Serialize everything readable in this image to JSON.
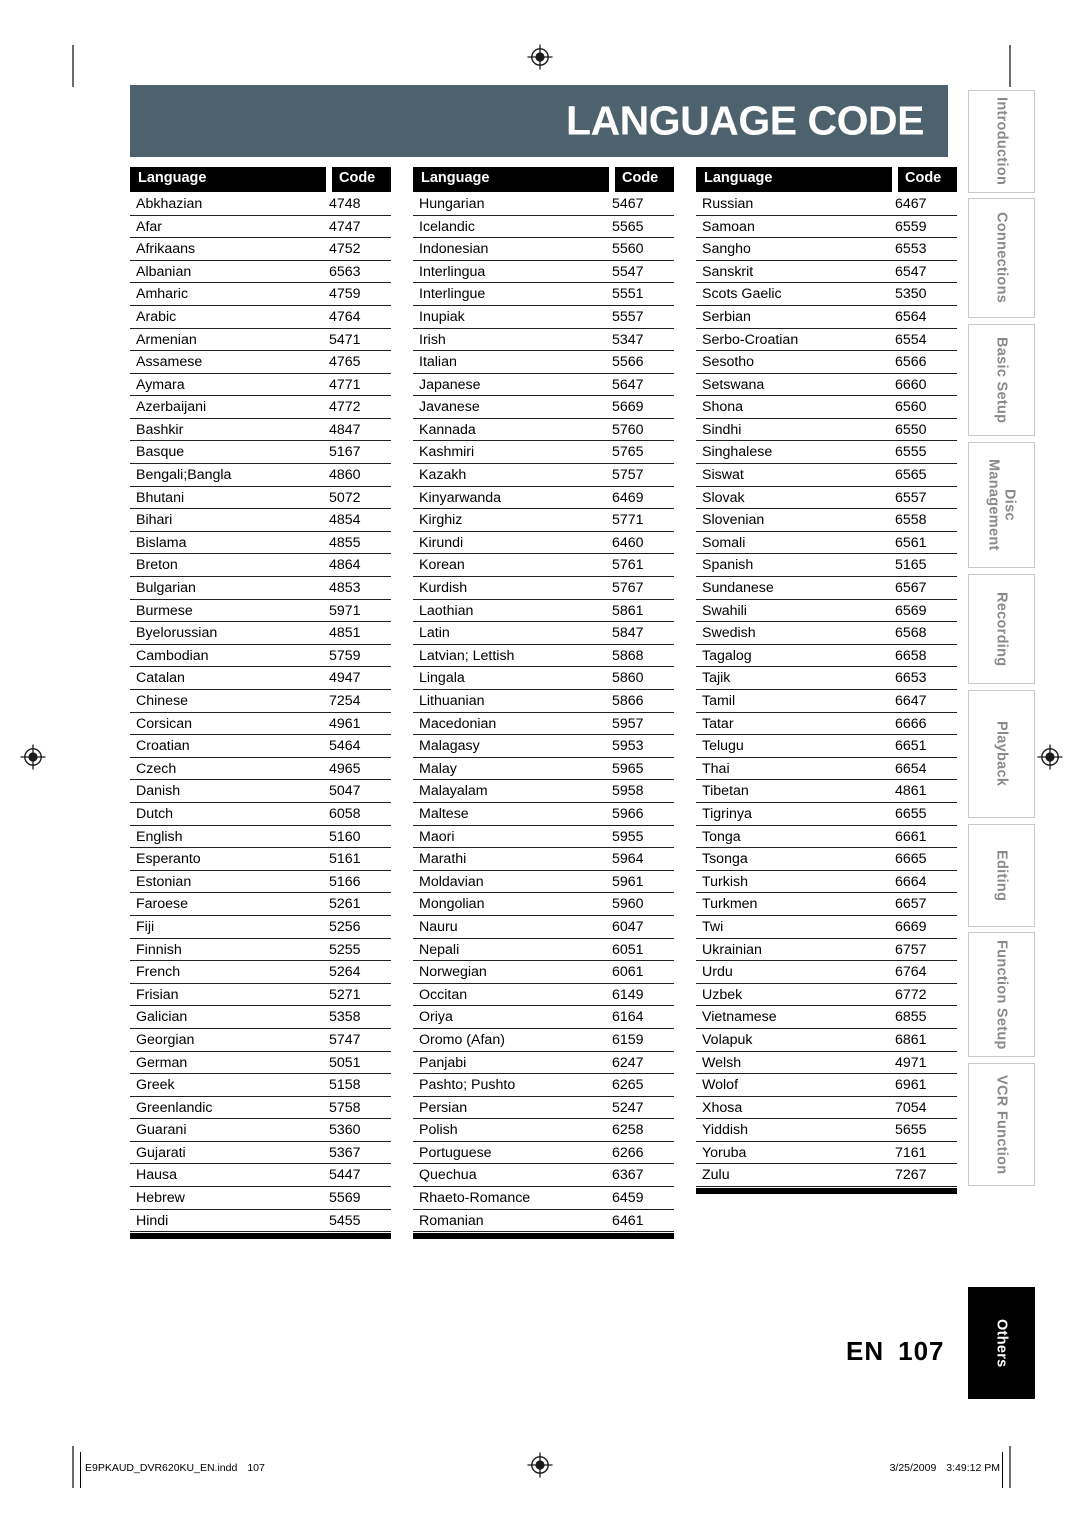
{
  "document": {
    "title": "LANGUAGE CODE",
    "page_label_prefix": "EN",
    "page_number": "107"
  },
  "table": {
    "headers": {
      "language": "Language",
      "code": "Code"
    },
    "columns": [
      {
        "rows": [
          {
            "language": "Abkhazian",
            "code": "4748"
          },
          {
            "language": "Afar",
            "code": "4747"
          },
          {
            "language": "Afrikaans",
            "code": "4752"
          },
          {
            "language": "Albanian",
            "code": "6563"
          },
          {
            "language": "Amharic",
            "code": "4759"
          },
          {
            "language": "Arabic",
            "code": "4764"
          },
          {
            "language": "Armenian",
            "code": "5471"
          },
          {
            "language": "Assamese",
            "code": "4765"
          },
          {
            "language": "Aymara",
            "code": "4771"
          },
          {
            "language": "Azerbaijani",
            "code": "4772"
          },
          {
            "language": "Bashkir",
            "code": "4847"
          },
          {
            "language": "Basque",
            "code": "5167"
          },
          {
            "language": "Bengali;Bangla",
            "code": "4860"
          },
          {
            "language": "Bhutani",
            "code": "5072"
          },
          {
            "language": "Bihari",
            "code": "4854"
          },
          {
            "language": "Bislama",
            "code": "4855"
          },
          {
            "language": "Breton",
            "code": "4864"
          },
          {
            "language": "Bulgarian",
            "code": "4853"
          },
          {
            "language": "Burmese",
            "code": "5971"
          },
          {
            "language": "Byelorussian",
            "code": "4851"
          },
          {
            "language": "Cambodian",
            "code": "5759"
          },
          {
            "language": "Catalan",
            "code": "4947"
          },
          {
            "language": "Chinese",
            "code": "7254"
          },
          {
            "language": "Corsican",
            "code": "4961"
          },
          {
            "language": "Croatian",
            "code": "5464"
          },
          {
            "language": "Czech",
            "code": "4965"
          },
          {
            "language": "Danish",
            "code": "5047"
          },
          {
            "language": "Dutch",
            "code": "6058"
          },
          {
            "language": "English",
            "code": "5160"
          },
          {
            "language": "Esperanto",
            "code": "5161"
          },
          {
            "language": "Estonian",
            "code": "5166"
          },
          {
            "language": "Faroese",
            "code": "5261"
          },
          {
            "language": "Fiji",
            "code": "5256"
          },
          {
            "language": "Finnish",
            "code": "5255"
          },
          {
            "language": "French",
            "code": "5264"
          },
          {
            "language": "Frisian",
            "code": "5271"
          },
          {
            "language": "Galician",
            "code": "5358"
          },
          {
            "language": "Georgian",
            "code": "5747"
          },
          {
            "language": "German",
            "code": "5051"
          },
          {
            "language": "Greek",
            "code": "5158"
          },
          {
            "language": "Greenlandic",
            "code": "5758"
          },
          {
            "language": "Guarani",
            "code": "5360"
          },
          {
            "language": "Gujarati",
            "code": "5367"
          },
          {
            "language": "Hausa",
            "code": "5447"
          },
          {
            "language": "Hebrew",
            "code": "5569"
          },
          {
            "language": "Hindi",
            "code": "5455"
          }
        ]
      },
      {
        "rows": [
          {
            "language": "Hungarian",
            "code": "5467"
          },
          {
            "language": "Icelandic",
            "code": "5565"
          },
          {
            "language": "Indonesian",
            "code": "5560"
          },
          {
            "language": "Interlingua",
            "code": "5547"
          },
          {
            "language": "Interlingue",
            "code": "5551"
          },
          {
            "language": "Inupiak",
            "code": "5557"
          },
          {
            "language": "Irish",
            "code": "5347"
          },
          {
            "language": "Italian",
            "code": "5566"
          },
          {
            "language": "Japanese",
            "code": "5647"
          },
          {
            "language": "Javanese",
            "code": "5669"
          },
          {
            "language": "Kannada",
            "code": "5760"
          },
          {
            "language": "Kashmiri",
            "code": "5765"
          },
          {
            "language": "Kazakh",
            "code": "5757"
          },
          {
            "language": "Kinyarwanda",
            "code": "6469"
          },
          {
            "language": "Kirghiz",
            "code": "5771"
          },
          {
            "language": "Kirundi",
            "code": "6460"
          },
          {
            "language": "Korean",
            "code": "5761"
          },
          {
            "language": "Kurdish",
            "code": "5767"
          },
          {
            "language": "Laothian",
            "code": "5861"
          },
          {
            "language": "Latin",
            "code": "5847"
          },
          {
            "language": "Latvian; Lettish",
            "code": "5868"
          },
          {
            "language": "Lingala",
            "code": "5860"
          },
          {
            "language": "Lithuanian",
            "code": "5866"
          },
          {
            "language": "Macedonian",
            "code": "5957"
          },
          {
            "language": "Malagasy",
            "code": "5953"
          },
          {
            "language": "Malay",
            "code": "5965"
          },
          {
            "language": "Malayalam",
            "code": "5958"
          },
          {
            "language": "Maltese",
            "code": "5966"
          },
          {
            "language": "Maori",
            "code": "5955"
          },
          {
            "language": "Marathi",
            "code": "5964"
          },
          {
            "language": "Moldavian",
            "code": "5961"
          },
          {
            "language": "Mongolian",
            "code": "5960"
          },
          {
            "language": "Nauru",
            "code": "6047"
          },
          {
            "language": "Nepali",
            "code": "6051"
          },
          {
            "language": "Norwegian",
            "code": "6061"
          },
          {
            "language": "Occitan",
            "code": "6149"
          },
          {
            "language": "Oriya",
            "code": "6164"
          },
          {
            "language": "Oromo (Afan)",
            "code": "6159"
          },
          {
            "language": "Panjabi",
            "code": "6247"
          },
          {
            "language": "Pashto; Pushto",
            "code": "6265"
          },
          {
            "language": "Persian",
            "code": "5247"
          },
          {
            "language": "Polish",
            "code": "6258"
          },
          {
            "language": "Portuguese",
            "code": "6266"
          },
          {
            "language": "Quechua",
            "code": "6367"
          },
          {
            "language": "Rhaeto-Romance",
            "code": "6459"
          },
          {
            "language": "Romanian",
            "code": "6461"
          }
        ]
      },
      {
        "rows": [
          {
            "language": "Russian",
            "code": "6467"
          },
          {
            "language": "Samoan",
            "code": "6559"
          },
          {
            "language": "Sangho",
            "code": "6553"
          },
          {
            "language": "Sanskrit",
            "code": "6547"
          },
          {
            "language": "Scots Gaelic",
            "code": "5350"
          },
          {
            "language": "Serbian",
            "code": "6564"
          },
          {
            "language": "Serbo-Croatian",
            "code": "6554"
          },
          {
            "language": "Sesotho",
            "code": "6566"
          },
          {
            "language": "Setswana",
            "code": "6660"
          },
          {
            "language": "Shona",
            "code": "6560"
          },
          {
            "language": "Sindhi",
            "code": "6550"
          },
          {
            "language": "Singhalese",
            "code": "6555"
          },
          {
            "language": "Siswat",
            "code": "6565"
          },
          {
            "language": "Slovak",
            "code": "6557"
          },
          {
            "language": "Slovenian",
            "code": "6558"
          },
          {
            "language": "Somali",
            "code": "6561"
          },
          {
            "language": "Spanish",
            "code": "5165"
          },
          {
            "language": "Sundanese",
            "code": "6567"
          },
          {
            "language": "Swahili",
            "code": "6569"
          },
          {
            "language": "Swedish",
            "code": "6568"
          },
          {
            "language": "Tagalog",
            "code": "6658"
          },
          {
            "language": "Tajik",
            "code": "6653"
          },
          {
            "language": "Tamil",
            "code": "6647"
          },
          {
            "language": "Tatar",
            "code": "6666"
          },
          {
            "language": "Telugu",
            "code": "6651"
          },
          {
            "language": "Thai",
            "code": "6654"
          },
          {
            "language": "Tibetan",
            "code": "4861"
          },
          {
            "language": "Tigrinya",
            "code": "6655"
          },
          {
            "language": "Tonga",
            "code": "6661"
          },
          {
            "language": "Tsonga",
            "code": "6665"
          },
          {
            "language": "Turkish",
            "code": "6664"
          },
          {
            "language": "Turkmen",
            "code": "6657"
          },
          {
            "language": "Twi",
            "code": "6669"
          },
          {
            "language": "Ukrainian",
            "code": "6757"
          },
          {
            "language": "Urdu",
            "code": "6764"
          },
          {
            "language": "Uzbek",
            "code": "6772"
          },
          {
            "language": "Vietnamese",
            "code": "6855"
          },
          {
            "language": "Volapuk",
            "code": "6861"
          },
          {
            "language": "Welsh",
            "code": "4971"
          },
          {
            "language": "Wolof",
            "code": "6961"
          },
          {
            "language": "Xhosa",
            "code": "7054"
          },
          {
            "language": "Yiddish",
            "code": "5655"
          },
          {
            "language": "Yoruba",
            "code": "7161"
          },
          {
            "language": "Zulu",
            "code": "7267"
          }
        ]
      }
    ]
  },
  "tab_rail": {
    "tabs": [
      {
        "label": "Introduction",
        "active": false
      },
      {
        "label": "Connections",
        "active": false
      },
      {
        "label": "Basic Setup",
        "active": false
      },
      {
        "label": "Disc\nManagement",
        "active": false
      },
      {
        "label": "Recording",
        "active": false
      },
      {
        "label": "Playback",
        "active": false
      },
      {
        "label": "Editing",
        "active": false
      },
      {
        "label": "Function Setup",
        "active": false
      },
      {
        "label": "VCR Function",
        "active": false
      },
      {
        "label": "Others",
        "active": true
      }
    ]
  },
  "footer": {
    "file_name": "E9PKAUD_DVR620KU_EN.indd",
    "file_page": "107",
    "date": "3/25/2009",
    "time": "3:49:12 PM"
  },
  "colors": {
    "banner": "#4e626e",
    "header_block": "#000000",
    "tab_inactive_text": "#8a8a8a",
    "tab_active_bg": "#000000",
    "rule": "#231f20"
  }
}
